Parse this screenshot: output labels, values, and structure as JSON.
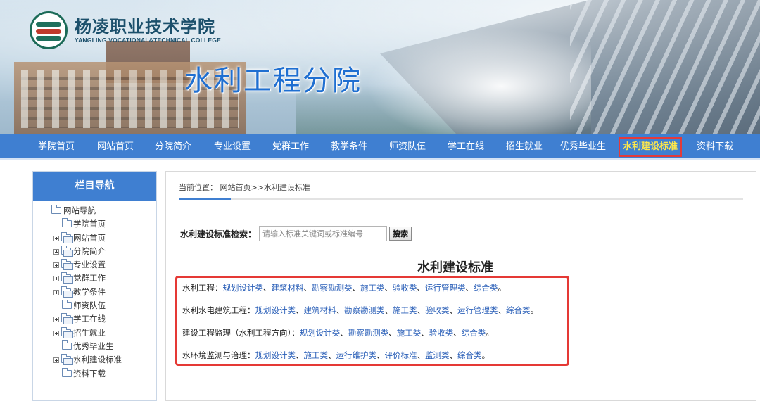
{
  "header": {
    "college_name_cn": "杨凌职业技术学院",
    "college_name_en": "YANGLING VOCATIONAL&TECHNICAL COLLEGE",
    "department_title": "水利工程分院"
  },
  "nav": {
    "items": [
      {
        "label": "学院首页"
      },
      {
        "label": "网站首页"
      },
      {
        "label": "分院简介"
      },
      {
        "label": "专业设置"
      },
      {
        "label": "党群工作"
      },
      {
        "label": "教学条件"
      },
      {
        "label": "师资队伍"
      },
      {
        "label": "学工在线"
      },
      {
        "label": "招生就业"
      },
      {
        "label": "优秀毕业生"
      },
      {
        "label": "水利建设标准",
        "active": true
      },
      {
        "label": "资料下载"
      }
    ],
    "colors": {
      "bar": "#3f7fd1",
      "active_text": "#ffe84a",
      "highlight_border": "#e33b3b"
    }
  },
  "sidebar": {
    "title": "栏目导航",
    "root": "网站导航",
    "items": [
      {
        "label": "学院首页",
        "expandable": false
      },
      {
        "label": "网站首页",
        "expandable": true
      },
      {
        "label": "分院简介",
        "expandable": true
      },
      {
        "label": "专业设置",
        "expandable": true
      },
      {
        "label": "党群工作",
        "expandable": true
      },
      {
        "label": "教学条件",
        "expandable": true
      },
      {
        "label": "师资队伍",
        "expandable": false
      },
      {
        "label": "学工在线",
        "expandable": true
      },
      {
        "label": "招生就业",
        "expandable": true
      },
      {
        "label": "优秀毕业生",
        "expandable": false
      },
      {
        "label": "水利建设标准",
        "expandable": true
      },
      {
        "label": "资料下载",
        "expandable": false
      }
    ]
  },
  "breadcrumb": {
    "prefix": "当前位置：",
    "path": "网站首页>>水利建设标准"
  },
  "search": {
    "label": "水利建设标准检索：",
    "placeholder": "请输入标准关键词或标准编号",
    "button": "搜索"
  },
  "main": {
    "heading": "水利建设标准",
    "standards": [
      {
        "category": "水利工程：",
        "links": [
          "规划设计类",
          "建筑材料",
          "勘察勘测类",
          "施工类",
          "验收类",
          "运行管理类",
          "综合类"
        ]
      },
      {
        "category": "水利水电建筑工程：",
        "links": [
          "规划设计类",
          "建筑材料",
          "勘察勘测类",
          "施工类",
          "验收类",
          "运行管理类",
          "综合类"
        ]
      },
      {
        "category": "建设工程监理（水利工程方向）：",
        "links": [
          "规划设计类",
          "勘察勘测类",
          "施工类",
          "验收类",
          "综合类"
        ]
      },
      {
        "category": "水环境监测与治理：",
        "links": [
          "规划设计类",
          "施工类",
          "运行维护类",
          "评价标准",
          "监测类",
          "综合类"
        ]
      }
    ],
    "separator": "、",
    "terminator": "。",
    "colors": {
      "link": "#2a5fb8",
      "highlight_box": "#e53935"
    }
  }
}
